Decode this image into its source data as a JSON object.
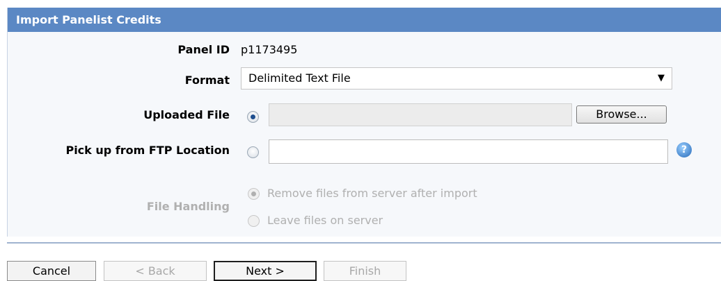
{
  "dialog": {
    "title": "Import Panelist Credits"
  },
  "fields": {
    "panel_id": {
      "label": "Panel ID",
      "value": "p1173495"
    },
    "format": {
      "label": "Format",
      "value": "Delimited Text File"
    },
    "uploaded_file": {
      "label": "Uploaded File",
      "browse_label": "Browse..."
    },
    "ftp": {
      "label": "Pick up from FTP Location",
      "help": "?"
    },
    "file_handling": {
      "label": "File Handling",
      "options": [
        "Remove files from server after import",
        "Leave files on server"
      ]
    }
  },
  "footer": {
    "cancel": "Cancel",
    "back": "< Back",
    "next": "Next >",
    "finish": "Finish"
  },
  "colors": {
    "titlebar": "#5b88c4",
    "panel_bg": "#f6f8fb",
    "disabled_text": "#b0b0b0"
  }
}
